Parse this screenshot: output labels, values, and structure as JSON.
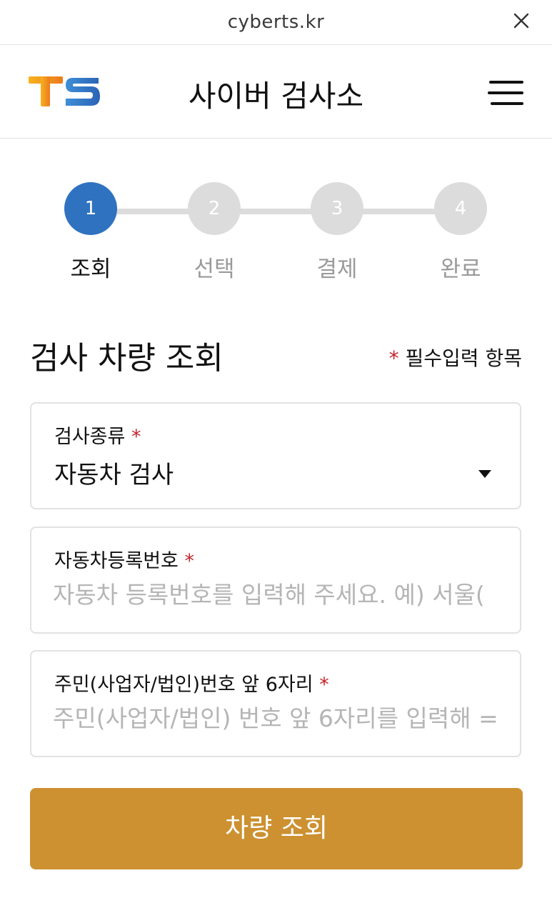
{
  "browser": {
    "url": "cyberts.kr",
    "close_icon": "close-icon"
  },
  "header": {
    "logo_text": "TS",
    "title": "사이버 검사소",
    "menu_icon": "hamburger-menu-icon"
  },
  "steps": [
    {
      "number": "1",
      "label": "조회",
      "active": true
    },
    {
      "number": "2",
      "label": "선택",
      "active": false
    },
    {
      "number": "3",
      "label": "결제",
      "active": false
    },
    {
      "number": "4",
      "label": "완료",
      "active": false
    }
  ],
  "colors": {
    "active_step": "#2f72c0",
    "inactive_step": "#dcdcdc",
    "required_star": "#c2262b",
    "submit_button": "#cd9131"
  },
  "form": {
    "title": "검사 차량 조회",
    "required_note_star": "*",
    "required_note": "필수입력 항목",
    "inspection_type": {
      "label": "검사종류",
      "required_star": "*",
      "value": "자동차 검사"
    },
    "plate_number": {
      "label": "자동차등록번호",
      "required_star": "*",
      "value": "",
      "placeholder": "자동차 등록번호를 입력해 주세요. 예) 서울("
    },
    "id_number": {
      "label": "주민(사업자/법인)번호 앞 6자리",
      "required_star": "*",
      "value": "",
      "placeholder": "주민(사업자/법인) 번호 앞 6자리를 입력해 ="
    },
    "submit_label": "차량 조회"
  }
}
